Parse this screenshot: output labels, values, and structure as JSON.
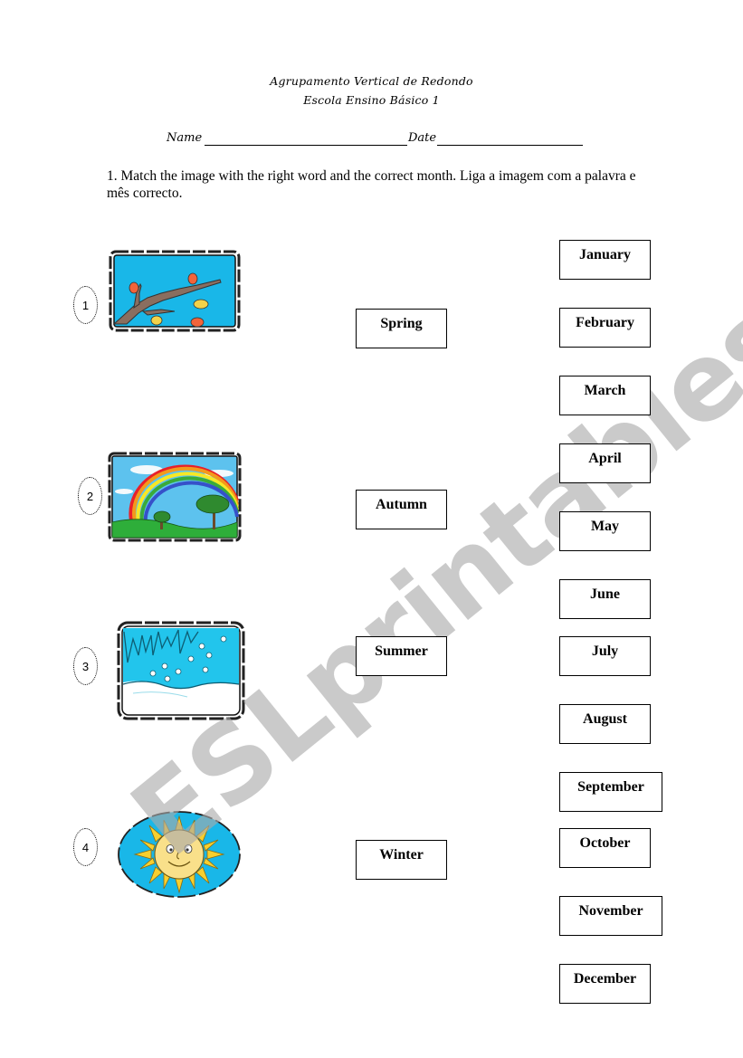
{
  "header": {
    "school_group": "Agrupamento Vertical de Redondo",
    "school_name": "Escola Ensino Básico 1",
    "name_label": "Name",
    "date_label": "Date"
  },
  "instruction": "1. Match the image with the right word and the correct month. Liga a imagem com a palavra e mês correcto.",
  "images": [
    {
      "number": "1",
      "icon": "autumn-branch-leaves-icon"
    },
    {
      "number": "2",
      "icon": "rainbow-landscape-icon"
    },
    {
      "number": "3",
      "icon": "icicles-snow-icon"
    },
    {
      "number": "4",
      "icon": "smiling-sun-icon"
    }
  ],
  "seasons": [
    "Spring",
    "Autumn",
    "Summer",
    "Winter"
  ],
  "months": [
    "January",
    "February",
    "March",
    "April",
    "May",
    "June",
    "July",
    "August",
    "September",
    "October",
    "November",
    "December"
  ],
  "watermark": "ESLprintables.com",
  "colors": {
    "sky_blue": "#19b7e8",
    "watermark_gray": "#c8c8c8"
  }
}
